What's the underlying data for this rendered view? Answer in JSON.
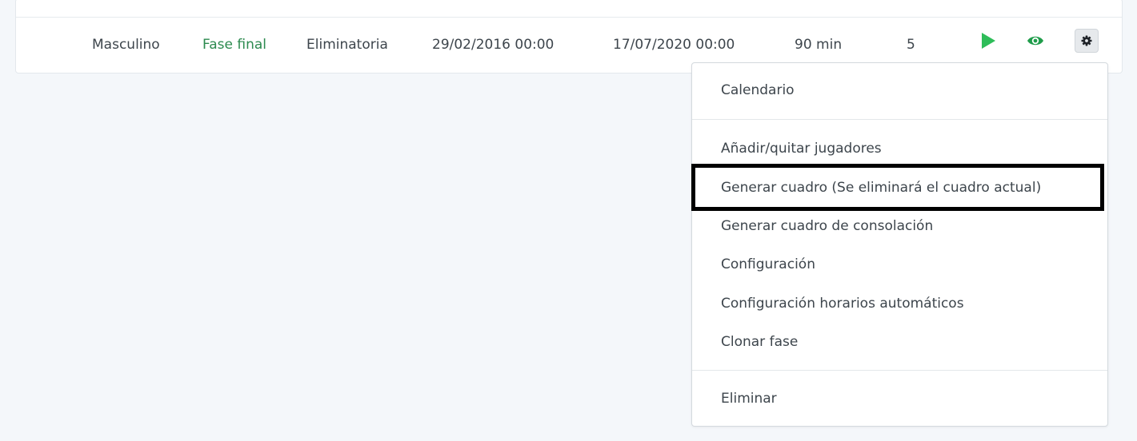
{
  "row": {
    "gender": "Masculino",
    "phase": "Fase final",
    "type": "Eliminatoria",
    "start_date": "29/02/2016 00:00",
    "end_date": "17/07/2020 00:00",
    "duration": "90 min",
    "count": "5",
    "actions": {
      "play_icon": "play-icon",
      "view_icon": "eye-icon",
      "settings_icon": "gear-icon"
    }
  },
  "colors": {
    "accent_green": "#2ebd59",
    "link_green": "#2c8a4f",
    "highlight": "#000000"
  },
  "menu": {
    "items": [
      {
        "label": "Calendario"
      },
      {
        "label": "Añadir/quitar jugadores"
      },
      {
        "label": "Generar cuadro (Se eliminará el cuadro actual)"
      },
      {
        "label": "Generar cuadro de consolación"
      },
      {
        "label": "Configuración"
      },
      {
        "label": "Configuración horarios automáticos"
      },
      {
        "label": "Clonar fase"
      },
      {
        "label": "Eliminar"
      }
    ],
    "highlighted_item": "Generar cuadro (Se eliminará el cuadro actual)"
  }
}
